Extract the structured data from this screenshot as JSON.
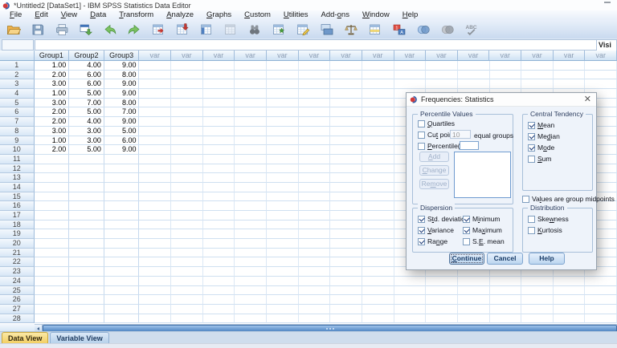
{
  "window": {
    "title": "*Untitled2 [DataSet1] - IBM SPSS Statistics Data Editor",
    "visible_label": "Visi"
  },
  "menu": {
    "items": [
      {
        "text": "File",
        "u": 0
      },
      {
        "text": "Edit",
        "u": 0
      },
      {
        "text": "View",
        "u": 0
      },
      {
        "text": "Data",
        "u": 0
      },
      {
        "text": "Transform",
        "u": 0
      },
      {
        "text": "Analyze",
        "u": 0
      },
      {
        "text": "Graphs",
        "u": 0
      },
      {
        "text": "Custom",
        "u": 0
      },
      {
        "text": "Utilities",
        "u": 0
      },
      {
        "text": "Add-ons",
        "u": 4
      },
      {
        "text": "Window",
        "u": 0
      },
      {
        "text": "Help",
        "u": 0
      }
    ]
  },
  "toolbar": {
    "icons": [
      "open-data",
      "save",
      "print",
      "recall-dialogs",
      "undo",
      "redo",
      "goto-case",
      "insert-case",
      "goto-variable",
      "variables",
      "find",
      "insert-cases",
      "insert-variable",
      "split-file",
      "weight-cases",
      "select-cases",
      "value-labels",
      "use-variable-sets",
      "show-all-variables",
      "spell-check"
    ]
  },
  "refbar": {
    "cell_reference": "",
    "cell_editor": ""
  },
  "grid": {
    "columns": [
      "Group1",
      "Group2",
      "Group3"
    ],
    "var_label": "var",
    "var_count": 15,
    "visible_rows": 28,
    "rows": [
      [
        "1.00",
        "4.00",
        "9.00"
      ],
      [
        "2.00",
        "6.00",
        "8.00"
      ],
      [
        "3.00",
        "6.00",
        "9.00"
      ],
      [
        "1.00",
        "5.00",
        "9.00"
      ],
      [
        "3.00",
        "7.00",
        "8.00"
      ],
      [
        "2.00",
        "5.00",
        "7.00"
      ],
      [
        "2.00",
        "4.00",
        "9.00"
      ],
      [
        "3.00",
        "3.00",
        "5.00"
      ],
      [
        "1.00",
        "3.00",
        "6.00"
      ],
      [
        "2.00",
        "5.00",
        "9.00"
      ]
    ]
  },
  "tabs": [
    {
      "label": "Data View",
      "active": true
    },
    {
      "label": "Variable View",
      "active": false
    }
  ],
  "dialog": {
    "title": "Frequencies: Statistics",
    "percentile": {
      "label": "Percentile Values",
      "quartiles": {
        "text": "Quartiles",
        "u": 0,
        "checked": false
      },
      "cut_points": {
        "text": "Cut points for:",
        "u": 2,
        "checked": false
      },
      "cut_value": "10",
      "equal_groups": "equal groups",
      "percentiles": {
        "text": "Percentile(s):",
        "u": 0,
        "checked": false
      },
      "percentile_value": "",
      "add": {
        "text": "Add",
        "u": 0
      },
      "change": {
        "text": "Change",
        "u": 0
      },
      "remove": {
        "text": "Remove",
        "u": 2
      }
    },
    "central": {
      "label": "Central Tendency",
      "items": [
        {
          "text": "Mean",
          "u": 0,
          "checked": true
        },
        {
          "text": "Median",
          "u": 2,
          "checked": true
        },
        {
          "text": "Mode",
          "u": 1,
          "checked": true
        },
        {
          "text": "Sum",
          "u": 0,
          "checked": false
        }
      ]
    },
    "midpoints": {
      "text": "Values are group midpoints",
      "u": 2,
      "checked": false
    },
    "dispersion": {
      "label": "Dispersion",
      "col1": [
        {
          "text": "Std. deviation",
          "u": 1,
          "checked": true
        },
        {
          "text": "Variance",
          "u": 0,
          "checked": true
        },
        {
          "text": "Range",
          "u": 2,
          "checked": true
        }
      ],
      "col2": [
        {
          "text": "Minimum",
          "u": 1,
          "checked": true
        },
        {
          "text": "Maximum",
          "u": 2,
          "checked": true
        },
        {
          "text": "S.E. mean",
          "u": 2,
          "checked": false
        }
      ]
    },
    "distribution": {
      "label": "Distribution",
      "items": [
        {
          "text": "Skewness",
          "u": 3,
          "checked": false
        },
        {
          "text": "Kurtosis",
          "u": 0,
          "checked": false
        }
      ]
    },
    "buttons": {
      "continue": {
        "text": "Continue",
        "u": 0
      },
      "cancel": {
        "text": "Cancel",
        "u": null
      },
      "help": {
        "text": "Help",
        "u": null
      }
    }
  }
}
